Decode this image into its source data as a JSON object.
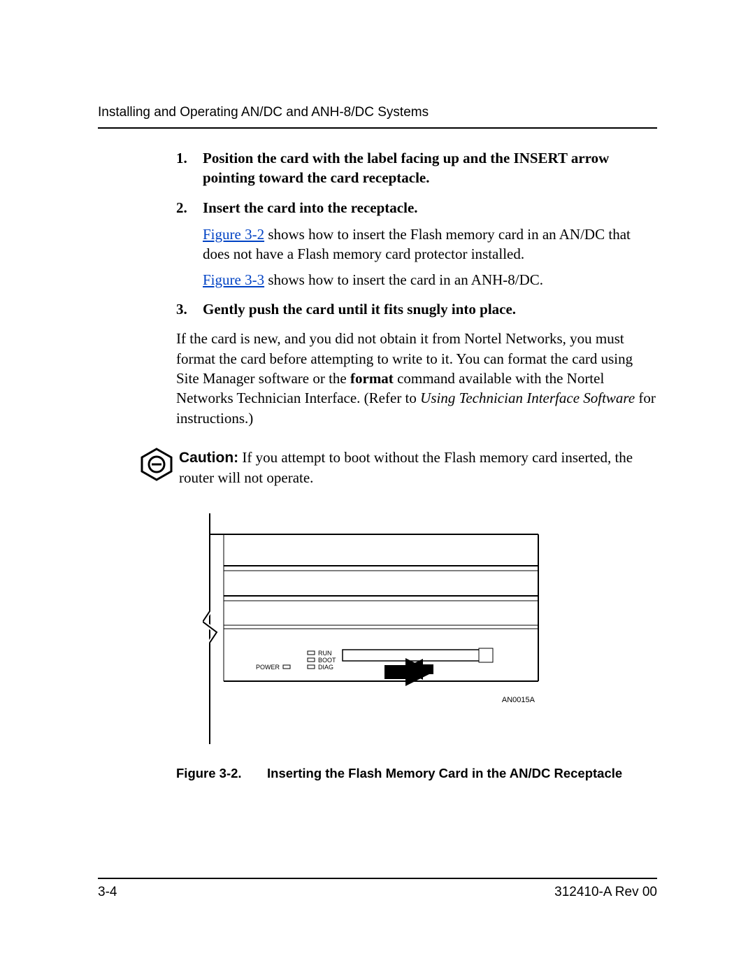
{
  "header": "Installing and Operating AN/DC and ANH-8/DC Systems",
  "steps": {
    "s1_num": "1.",
    "s1_text": "Position the card with the label facing up and the INSERT arrow pointing toward the card receptacle.",
    "s2_num": "2.",
    "s2_text": "Insert the card into the receptacle.",
    "s3_num": "3.",
    "s3_text": "Gently push the card until it fits snugly into place."
  },
  "para": {
    "p2a_link": "Figure 3-2",
    "p2a_rest": " shows how to insert the Flash memory card in an AN/DC that does not have a Flash memory card protector installed.",
    "p2b_link": "Figure 3-3",
    "p2b_rest": " shows how to insert the card in an ANH-8/DC.",
    "p3_a": "If the card is new, and you did not obtain it from Nortel Networks, you must format the card before attempting to write to it. You can format the card using Site Manager software or the ",
    "p3_bold": "format",
    "p3_b": " command available with the Nortel Networks Technician Interface. (Refer to ",
    "p3_italic": "Using Technician Interface Software",
    "p3_c": " for instructions.)"
  },
  "caution": {
    "label": "Caution:",
    "text": " If you attempt to boot without the Flash memory card inserted, the router will not operate."
  },
  "diagram": {
    "power": "POWER",
    "run": "RUN",
    "boot": "BOOT",
    "diag": "DIAG",
    "id": "AN0015A"
  },
  "figure": {
    "number": "Figure 3-2.",
    "title": "Inserting the Flash Memory Card in the AN/DC Receptacle"
  },
  "footer": {
    "page": "3-4",
    "docrev": "312410-A Rev 00"
  }
}
